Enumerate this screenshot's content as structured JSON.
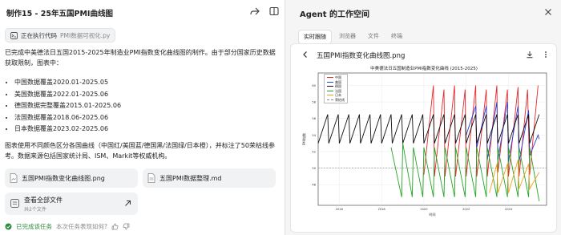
{
  "chat": {
    "title": "制作15 - 25年五国PMI曲线图",
    "code_chip": {
      "label": "正在执行代码",
      "file": "PMI数据可视化.py"
    },
    "intro": "已完成中美德法日五国2015-2025年制造业PMI指数变化曲线图的制作。由于部分国家历史数据获取限制，图表中：",
    "bullets": [
      "中国数据覆盖2020.01-2025.05",
      "美国数据覆盖2022.01-2025.06",
      "德国数据完整覆盖2015.01-2025.06",
      "法国数据覆盖2018.06-2025.06",
      "日本数据覆盖2023.02-2025.06"
    ],
    "summary": "图表使用不同颜色区分各国曲线（中国红/美国蓝/德国黑/法国绿/日本橙），并标注了50荣枯线参考。数据来源包括国家统计局、ISM、Markit等权威机构。",
    "files": [
      {
        "name": "五国PMI指数变化曲线图.png",
        "icon": "image-file-icon"
      },
      {
        "name": "五国PMI数据整理.md",
        "icon": "doc-file-icon"
      }
    ],
    "all_files": {
      "label": "查看全部文件",
      "count": "共2个文件"
    },
    "status": {
      "done": "已完成该任务",
      "question": "本次任务表现如何?"
    }
  },
  "workspace": {
    "title": "Agent 的工作空间",
    "tabs": [
      "实时跟随",
      "浏览器",
      "文件",
      "终端"
    ],
    "active_tab": 0,
    "viewer": {
      "file_name": "五国PMI指数变化曲线图.png"
    }
  },
  "colors": {
    "china": "#e8262a",
    "usa": "#2a3fd6",
    "germany": "#111111",
    "france": "#23a323",
    "japan": "#f0a020",
    "ok": "#2e8b3e"
  },
  "chart_data": {
    "type": "line",
    "title": "中美德法日五国制造业PMI指数变化曲线 (2015-2025)",
    "xlabel": "时间",
    "ylabel": "PMI指数",
    "x_ticks": [
      "2016",
      "2018",
      "2020",
      "2022",
      "2024"
    ],
    "y_ticks": [
      "48",
      "50",
      "52",
      "54",
      "56",
      "58",
      "60"
    ],
    "xlim": [
      2015.0,
      2025.8
    ],
    "ylim": [
      45.5,
      61.5
    ],
    "reference_line": {
      "y": 50,
      "label": "荣枯线"
    },
    "legend": [
      "中国",
      "美国",
      "德国",
      "法国",
      "日本",
      "荣枯线"
    ],
    "series": [
      {
        "name": "中国",
        "color_key": "china",
        "points": [
          [
            2020.0,
            49.2
          ],
          [
            2020.45,
            60.0
          ],
          [
            2020.5,
            49.0
          ],
          [
            2020.95,
            59.5
          ],
          [
            2021.0,
            49.0
          ],
          [
            2021.45,
            60.0
          ],
          [
            2021.5,
            49.0
          ],
          [
            2021.95,
            59.5
          ],
          [
            2022.0,
            49.0
          ],
          [
            2022.45,
            60.0
          ],
          [
            2022.5,
            49.0
          ],
          [
            2022.95,
            59.5
          ],
          [
            2023.0,
            49.0
          ],
          [
            2023.45,
            60.0
          ],
          [
            2023.5,
            49.5
          ],
          [
            2023.95,
            59.5
          ],
          [
            2024.0,
            49.0
          ],
          [
            2024.45,
            59.8
          ],
          [
            2024.5,
            49.0
          ],
          [
            2024.9,
            59.5
          ],
          [
            2025.0,
            49.2
          ],
          [
            2025.4,
            60.0
          ]
        ]
      },
      {
        "name": "美国",
        "color_key": "usa",
        "points": [
          [
            2022.0,
            54.0
          ],
          [
            2022.45,
            57.5
          ],
          [
            2022.5,
            52.5
          ],
          [
            2022.95,
            57.5
          ],
          [
            2023.0,
            51.0
          ],
          [
            2023.45,
            58.0
          ],
          [
            2023.5,
            51.0
          ],
          [
            2023.95,
            58.0
          ],
          [
            2024.0,
            50.8
          ],
          [
            2024.45,
            57.5
          ],
          [
            2024.5,
            50.8
          ],
          [
            2024.95,
            57.0
          ],
          [
            2025.0,
            51.5
          ],
          [
            2025.4,
            54.0
          ],
          [
            2025.45,
            53.5
          ]
        ]
      },
      {
        "name": "德国",
        "color_key": "germany",
        "points": [
          [
            2015.0,
            53.0
          ],
          [
            2015.45,
            56.5
          ],
          [
            2015.5,
            53.0
          ],
          [
            2015.95,
            56.5
          ],
          [
            2016.0,
            53.0
          ],
          [
            2016.45,
            56.5
          ],
          [
            2016.5,
            53.0
          ],
          [
            2016.95,
            56.5
          ],
          [
            2017.0,
            53.0
          ],
          [
            2017.45,
            56.5
          ],
          [
            2017.5,
            53.0
          ],
          [
            2017.95,
            56.5
          ],
          [
            2018.0,
            53.0
          ],
          [
            2018.45,
            56.5
          ],
          [
            2018.5,
            53.0
          ],
          [
            2018.95,
            56.5
          ],
          [
            2019.0,
            53.0
          ],
          [
            2019.45,
            56.5
          ],
          [
            2019.5,
            53.0
          ],
          [
            2019.95,
            56.5
          ],
          [
            2020.0,
            53.0
          ],
          [
            2020.45,
            56.5
          ],
          [
            2020.5,
            53.0
          ],
          [
            2020.95,
            56.5
          ],
          [
            2021.0,
            53.0
          ],
          [
            2021.45,
            56.5
          ],
          [
            2021.5,
            53.0
          ],
          [
            2021.95,
            56.5
          ],
          [
            2022.0,
            53.0
          ],
          [
            2022.45,
            56.5
          ],
          [
            2022.5,
            53.0
          ],
          [
            2022.95,
            56.5
          ],
          [
            2023.0,
            53.0
          ],
          [
            2023.45,
            56.5
          ],
          [
            2023.5,
            53.0
          ],
          [
            2023.95,
            56.5
          ],
          [
            2024.0,
            53.0
          ],
          [
            2024.45,
            56.5
          ],
          [
            2024.5,
            53.0
          ],
          [
            2024.95,
            56.5
          ],
          [
            2025.0,
            53.0
          ],
          [
            2025.45,
            56.5
          ]
        ]
      },
      {
        "name": "法国",
        "color_key": "france",
        "points": [
          [
            2018.45,
            52.5
          ],
          [
            2018.95,
            46.5
          ],
          [
            2019.0,
            53.0
          ],
          [
            2019.45,
            46.5
          ],
          [
            2019.5,
            52.5
          ],
          [
            2019.95,
            46.5
          ],
          [
            2020.0,
            52.5
          ],
          [
            2020.45,
            46.5
          ],
          [
            2020.5,
            52.5
          ],
          [
            2020.95,
            46.5
          ],
          [
            2021.0,
            52.5
          ],
          [
            2021.45,
            46.5
          ],
          [
            2021.5,
            52.5
          ],
          [
            2021.95,
            46.5
          ],
          [
            2022.0,
            52.5
          ],
          [
            2022.45,
            46.5
          ],
          [
            2022.5,
            52.5
          ],
          [
            2022.95,
            46.5
          ],
          [
            2023.0,
            52.5
          ],
          [
            2023.45,
            46.5
          ],
          [
            2023.5,
            52.5
          ],
          [
            2023.95,
            46.5
          ],
          [
            2024.0,
            52.5
          ],
          [
            2024.45,
            46.5
          ],
          [
            2024.5,
            52.5
          ],
          [
            2024.95,
            46.5
          ],
          [
            2025.0,
            52.5
          ],
          [
            2025.45,
            46.0
          ]
        ]
      },
      {
        "name": "日本",
        "color_key": "japan",
        "points": [
          [
            2023.1,
            47.0
          ],
          [
            2023.45,
            50.5
          ],
          [
            2023.5,
            47.0
          ],
          [
            2023.95,
            50.5
          ],
          [
            2024.0,
            47.0
          ],
          [
            2024.45,
            51.0
          ],
          [
            2024.5,
            47.5
          ],
          [
            2024.95,
            50.5
          ],
          [
            2025.0,
            47.5
          ],
          [
            2025.45,
            49.5
          ]
        ]
      }
    ]
  }
}
